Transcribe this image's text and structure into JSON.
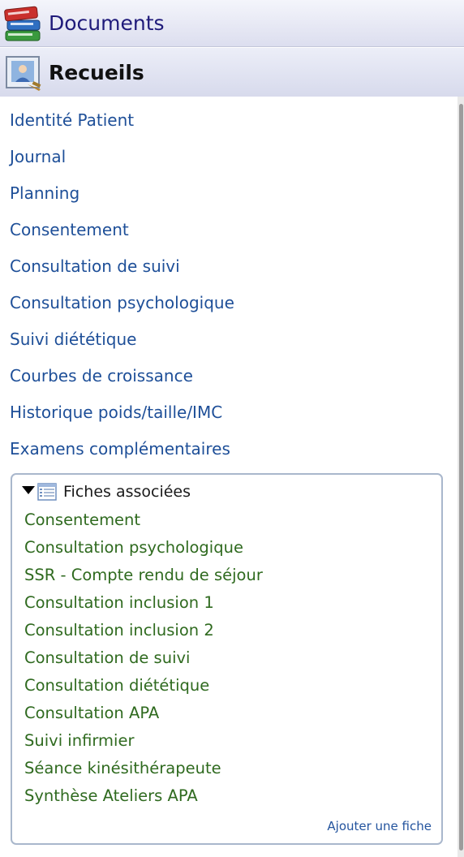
{
  "header_documents": {
    "title": "Documents",
    "icon": "books-icon"
  },
  "header_recueils": {
    "title": "Recueils",
    "icon": "portrait-frame-icon"
  },
  "nav": {
    "items": [
      {
        "label": "Identité Patient"
      },
      {
        "label": "Journal"
      },
      {
        "label": "Planning"
      },
      {
        "label": "Consentement"
      },
      {
        "label": "Consultation de suivi"
      },
      {
        "label": "Consultation psychologique"
      },
      {
        "label": "Suivi diététique"
      },
      {
        "label": "Courbes de croissance"
      },
      {
        "label": "Historique poids/taille/IMC"
      },
      {
        "label": "Examens complémentaires"
      }
    ]
  },
  "fiches_panel": {
    "title": "Fiches associées",
    "toggle_icon": "triangle-down-icon",
    "list_icon": "form-list-icon",
    "items": [
      {
        "label": "Consentement"
      },
      {
        "label": "Consultation psychologique"
      },
      {
        "label": "SSR - Compte rendu de séjour"
      },
      {
        "label": "Consultation inclusion 1"
      },
      {
        "label": "Consultation inclusion 2"
      },
      {
        "label": "Consultation de suivi"
      },
      {
        "label": "Consultation diététique"
      },
      {
        "label": "Consultation APA"
      },
      {
        "label": "Suivi infirmier"
      },
      {
        "label": "Séance kinésithérapeute"
      },
      {
        "label": "Synthèse Ateliers APA"
      }
    ],
    "add_label": "Ajouter une fiche"
  },
  "colors": {
    "nav_link": "#1e4f98",
    "fiche_link": "#2f6a1f",
    "documents_title": "#1f1a7a",
    "panel_border": "#a9b7cc"
  }
}
